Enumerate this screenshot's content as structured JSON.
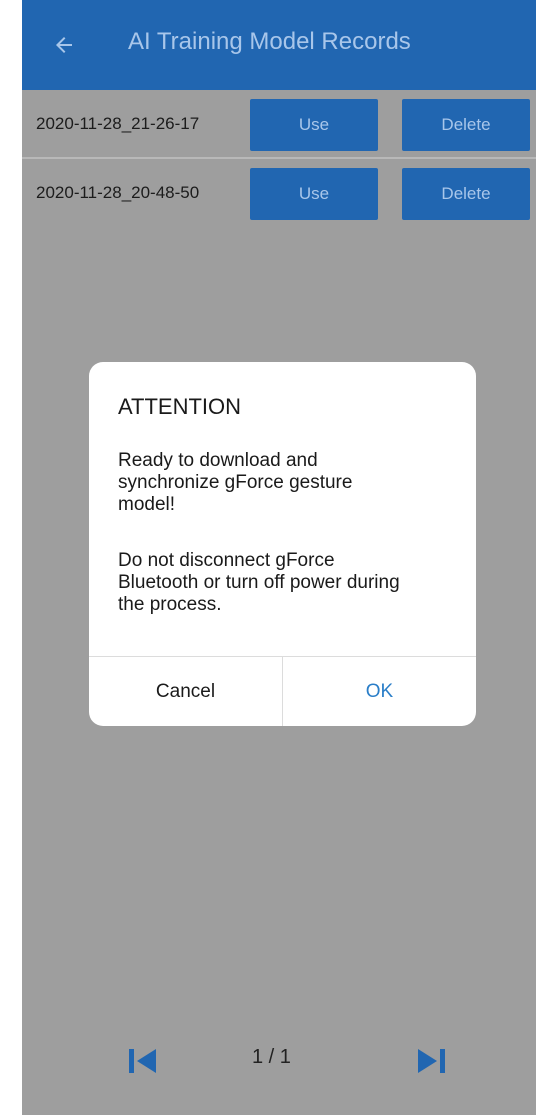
{
  "header": {
    "title": "AI Training Model Records",
    "back_icon": "arrow-left-icon"
  },
  "records": [
    {
      "date": "2020-11-28_21-26-17",
      "use_label": "Use",
      "delete_label": "Delete"
    },
    {
      "date": "2020-11-28_20-48-50",
      "use_label": "Use",
      "delete_label": "Delete"
    }
  ],
  "dialog": {
    "title": "ATTENTION",
    "message_1": "Ready to download and synchronize gForce gesture model!",
    "message_2": "Do not disconnect gForce Bluetooth or turn off power during the process.",
    "cancel_label": "Cancel",
    "ok_label": "OK"
  },
  "pager": {
    "indicator": "1 / 1",
    "first_icon": "skip-to-first-icon",
    "last_icon": "skip-to-last-icon"
  },
  "colors": {
    "primary": "#2166b1",
    "primary_text_dimmed": "#a8c6ea",
    "scrim": "#9e9e9e",
    "ok_text": "#2a7ec8"
  }
}
